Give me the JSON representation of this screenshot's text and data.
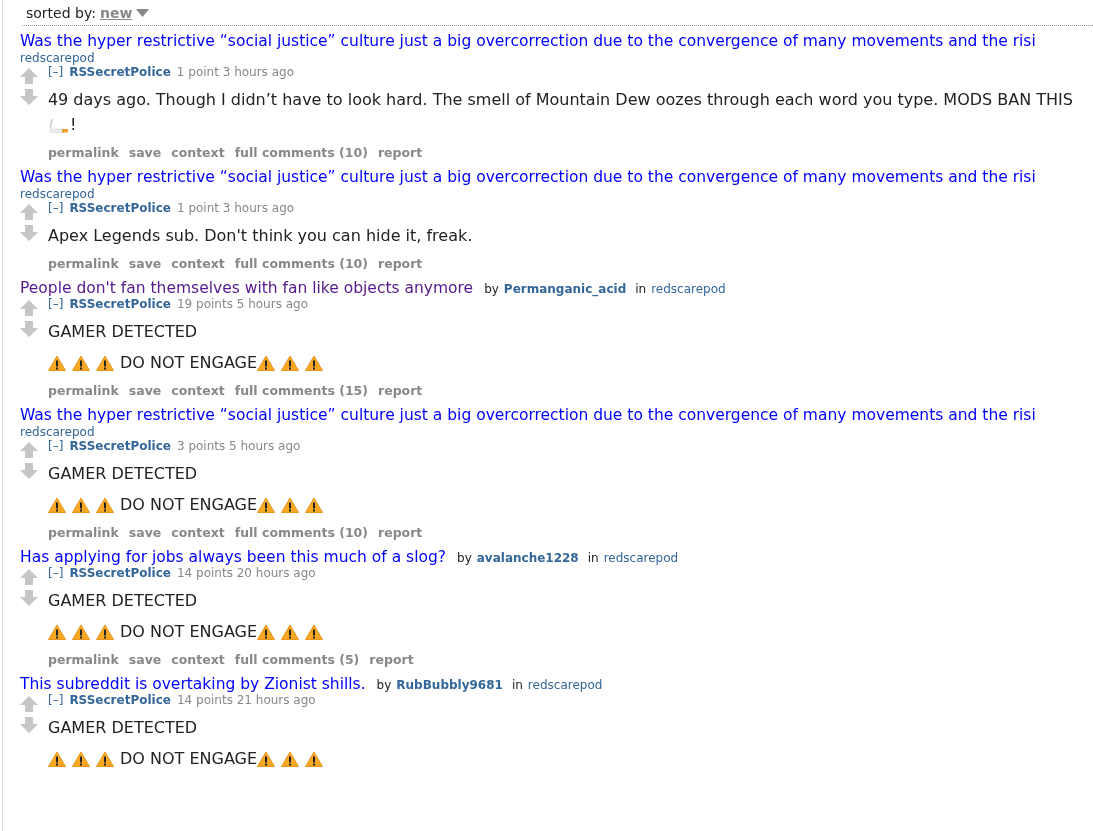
{
  "sort": {
    "label": "sorted by:",
    "value": "new"
  },
  "entries": [
    {
      "title": "Was the hyper restrictive “social justice” culture just a big overcorrection due to the convergence of many movements and the risi",
      "visited": false,
      "subreddit": "redscarepod",
      "toggle": "[–]",
      "user": "RSSecretPolice",
      "score": "1 point 3 hours ago",
      "body": [
        [
          {
            "kind": "text",
            "text": "49 days ago. Though I didn’t have to look hard. The smell of Mountain Dew oozes through each word you type. MODS BAN THIS "
          },
          {
            "kind": "cigarette"
          },
          {
            "kind": "text",
            "text": "!"
          }
        ]
      ],
      "actions": [
        "permalink",
        "save",
        "context",
        "full comments (10)",
        "report"
      ]
    },
    {
      "title": "Was the hyper restrictive “social justice” culture just a big overcorrection due to the convergence of many movements and the risi",
      "visited": false,
      "subreddit": "redscarepod",
      "toggle": "[–]",
      "user": "RSSecretPolice",
      "score": "1 point 3 hours ago",
      "body": [
        [
          {
            "kind": "text",
            "text": "Apex Legends sub. Don't think you can hide it, freak."
          }
        ]
      ],
      "actions": [
        "permalink",
        "save",
        "context",
        "full comments (10)",
        "report"
      ]
    },
    {
      "title": "People don't fan themselves with fan like objects anymore",
      "visited": true,
      "by": "by",
      "author": "Permanganic_acid",
      "in": "in",
      "subreddit": "redscarepod",
      "toggle": "[–]",
      "user": "RSSecretPolice",
      "score": "19 points 5 hours ago",
      "body": [
        [
          {
            "kind": "text",
            "text": "GAMER DETECTED"
          }
        ],
        [
          {
            "kind": "warning"
          },
          {
            "kind": "warning"
          },
          {
            "kind": "warning"
          },
          {
            "kind": "text",
            "text": "DO NOT ENGAGE"
          },
          {
            "kind": "warning"
          },
          {
            "kind": "warning"
          },
          {
            "kind": "warning"
          }
        ]
      ],
      "actions": [
        "permalink",
        "save",
        "context",
        "full comments (15)",
        "report"
      ]
    },
    {
      "title": "Was the hyper restrictive “social justice” culture just a big overcorrection due to the convergence of many movements and the risi",
      "visited": false,
      "subreddit": "redscarepod",
      "toggle": "[–]",
      "user": "RSSecretPolice",
      "score": "3 points 5 hours ago",
      "body": [
        [
          {
            "kind": "text",
            "text": "GAMER DETECTED"
          }
        ],
        [
          {
            "kind": "warning"
          },
          {
            "kind": "warning"
          },
          {
            "kind": "warning"
          },
          {
            "kind": "text",
            "text": "DO NOT ENGAGE"
          },
          {
            "kind": "warning"
          },
          {
            "kind": "warning"
          },
          {
            "kind": "warning"
          }
        ]
      ],
      "actions": [
        "permalink",
        "save",
        "context",
        "full comments (10)",
        "report"
      ]
    },
    {
      "title": "Has applying for jobs always been this much of a slog?",
      "visited": false,
      "by": "by",
      "author": "avalanche1228",
      "in": "in",
      "subreddit": "redscarepod",
      "toggle": "[–]",
      "user": "RSSecretPolice",
      "score": "14 points 20 hours ago",
      "body": [
        [
          {
            "kind": "text",
            "text": "GAMER DETECTED"
          }
        ],
        [
          {
            "kind": "warning"
          },
          {
            "kind": "warning"
          },
          {
            "kind": "warning"
          },
          {
            "kind": "text",
            "text": "DO NOT ENGAGE"
          },
          {
            "kind": "warning"
          },
          {
            "kind": "warning"
          },
          {
            "kind": "warning"
          }
        ]
      ],
      "actions": [
        "permalink",
        "save",
        "context",
        "full comments (5)",
        "report"
      ]
    },
    {
      "title": "This subreddit is overtaking by Zionist shills.",
      "visited": false,
      "by": "by",
      "author": "RubBubbly9681",
      "in": "in",
      "subreddit": "redscarepod",
      "toggle": "[–]",
      "user": "RSSecretPolice",
      "score": "14 points 21 hours ago",
      "body": [
        [
          {
            "kind": "text",
            "text": "GAMER DETECTED"
          }
        ],
        [
          {
            "kind": "warning"
          },
          {
            "kind": "warning"
          },
          {
            "kind": "warning"
          },
          {
            "kind": "text",
            "text": "DO NOT ENGAGE"
          },
          {
            "kind": "warning"
          },
          {
            "kind": "warning"
          },
          {
            "kind": "warning"
          }
        ]
      ]
    }
  ]
}
